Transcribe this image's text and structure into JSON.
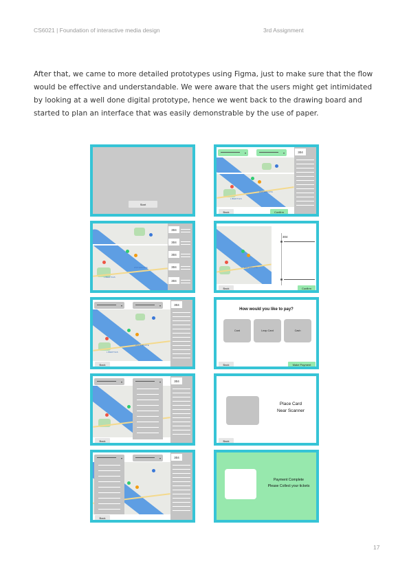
{
  "header": {
    "course": "CS6021 | Foundation of interactive media design",
    "assignment": "3rd Assignment"
  },
  "body_text": "After that, we came to more detailed prototypes using Figma, just to make sure that the flow would be effective and understandable. We were aware that the users might get intimidated by looking at a well done digital prototype, hence we went back to the drawing board and started to plan an interface that was easily demonstrable by the use of paper.",
  "page_number": "17",
  "colors": {
    "frame_border": "#36c4d6",
    "accent_green": "#97e8ad",
    "placeholder_grey": "#c4c4c4",
    "map_water": "#5e9ee3"
  },
  "prototypes": {
    "start_screen": {
      "start_label": "Start"
    },
    "route_select": {
      "number": "304",
      "back_label": "Back",
      "confirm_label": "Confirm"
    },
    "route_list": {
      "numbers": [
        "304",
        "304",
        "304",
        "304",
        "304"
      ]
    },
    "stop_select": {
      "number": "304",
      "back_label": "Back",
      "confirm_label": "Confirm"
    },
    "dropdown_closed": {
      "number": "304",
      "back_label": "Back"
    },
    "payment": {
      "title": "How would you like to pay?",
      "options": [
        "Card",
        "Leap Card",
        "Cash"
      ],
      "back_label": "Back",
      "make_payment_label": "Make Payment"
    },
    "dropdown_open": {
      "number": "304",
      "back_label": "Back"
    },
    "place_card": {
      "line1": "Place Card",
      "line2": "Near Scanner",
      "back_label": "Back"
    },
    "dropdown_open_2": {
      "number": "304",
      "back_label": "Back"
    },
    "complete": {
      "line1": "Payment Complete",
      "line2": "Please Collect your tickets"
    }
  },
  "map_labels": {
    "area": "LIBERTIES",
    "district": "WATERGATE",
    "small": [
      "Dublin Ct",
      "St. Kevin's",
      "Sth Amiens",
      "Trinity College"
    ]
  }
}
